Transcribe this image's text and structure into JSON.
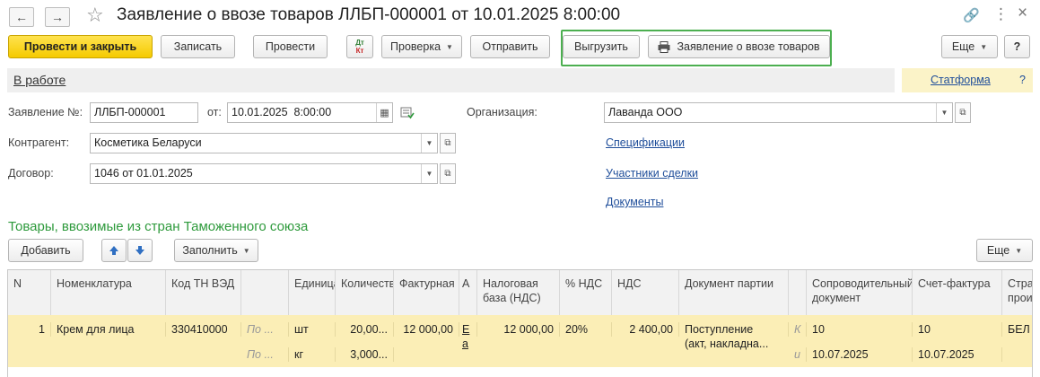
{
  "window": {
    "title": "Заявление о ввозе товаров ЛЛБП-000001 от 10.01.2025 8:00:00",
    "back": "←",
    "forward": "→",
    "star": "☆",
    "link": "🔗",
    "menu": "⋮",
    "close": "×"
  },
  "toolbar": {
    "post_close": "Провести и закрыть",
    "save": "Записать",
    "post": "Провести",
    "dtkt_top": "Дт",
    "dtkt_bottom": "Кт",
    "check": "Проверка",
    "send": "Отправить",
    "export": "Выгрузить",
    "print_statement": "Заявление о ввозе товаров",
    "more": "Еще",
    "help": "?"
  },
  "status": {
    "text": "В работе",
    "platform_link": "Статформа",
    "help": "?"
  },
  "form": {
    "number_label": "Заявление №:",
    "number_value": "ЛЛБП-000001",
    "date_label": "от:",
    "date_value": "10.01.2025  8:00:00",
    "org_label": "Организация:",
    "org_value": "Лаванда ООО",
    "counterparty_label": "Контрагент:",
    "counterparty_value": "Косметика Беларуси",
    "contract_label": "Договор:",
    "contract_value": "1046 от 01.01.2025",
    "links": {
      "specs": "Спецификации",
      "participants": "Участники сделки",
      "documents": "Документы"
    }
  },
  "goods": {
    "section_title": "Товары, ввозимые из стран Таможенного союза",
    "add": "Добавить",
    "fill": "Заполнить",
    "more": "Еще",
    "headers": {
      "n": "N",
      "nomenclature": "Номенклатура",
      "code": "Код ТН ВЭД",
      "blank": "",
      "unit": "Единица",
      "qty": "Количество",
      "invoice_value": "Фактурная",
      "a": "А",
      "tax_base": "Налоговая база (НДС)",
      "vat_rate": "% НДС",
      "vat": "НДС",
      "batch_doc": "Документ партии",
      "accomp_doc": "Сопроводительный документ",
      "invoice": "Счет-фактура",
      "country": "Страна происхождения"
    },
    "row": {
      "n": "1",
      "nomenclature": "Крем для лица",
      "code": "330410000",
      "po1": "По ...",
      "po2": "По ...",
      "unit1": "шт",
      "unit2": "кг",
      "qty1": "20,00...",
      "qty2": "3,000...",
      "invoice_value": "12 000,00",
      "a_top": "Е",
      "a_bottom": "а",
      "tax_base": "12 000,00",
      "vat_rate": "20%",
      "vat": "2 400,00",
      "batch_doc1": "Поступление",
      "batch_doc2": "(акт, накладна...",
      "k1": "К",
      "k2": "и",
      "accomp_num": "10",
      "accomp_date": "10.07.2025",
      "invoice_num": "10",
      "invoice_date": "10.07.2025",
      "country": "БЕЛ"
    }
  }
}
